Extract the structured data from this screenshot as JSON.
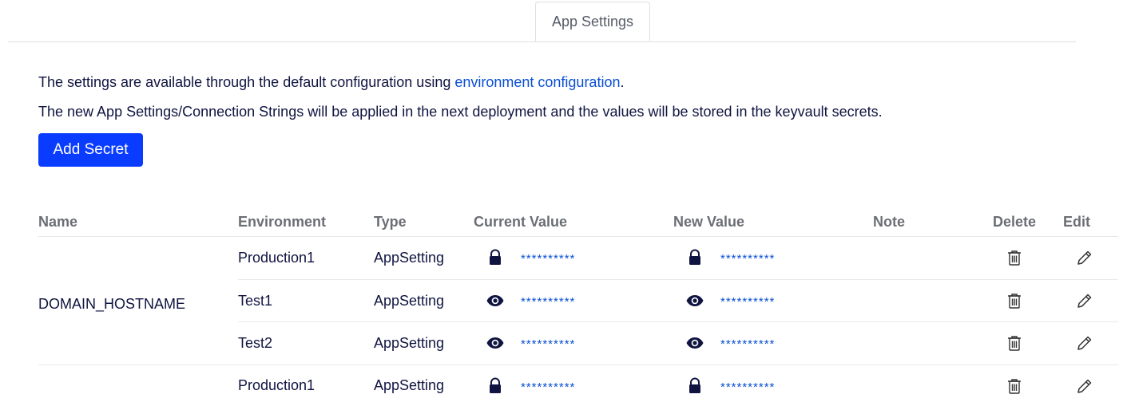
{
  "tabs": {
    "active": "App Settings"
  },
  "info": {
    "line1_prefix": "The settings are available through the default configuration using ",
    "line1_link": "environment configuration",
    "line1_suffix": ".",
    "line2": "The new App Settings/Connection Strings will be applied in the next deployment and the values will be stored in the keyvault secrets."
  },
  "actions": {
    "add_secret": "Add Secret"
  },
  "table": {
    "headers": {
      "name": "Name",
      "environment": "Environment",
      "type": "Type",
      "current_value": "Current Value",
      "new_value": "New Value",
      "note": "Note",
      "delete": "Delete",
      "edit": "Edit"
    },
    "groups": [
      {
        "name": "DOMAIN_HOSTNAME",
        "rows": [
          {
            "environment": "Production1",
            "type": "AppSetting",
            "current_icon": "lock-icon",
            "current_value": "**********",
            "new_icon": "lock-icon",
            "new_value": "**********",
            "note": ""
          },
          {
            "environment": "Test1",
            "type": "AppSetting",
            "current_icon": "eye-icon",
            "current_value": "**********",
            "new_icon": "eye-icon",
            "new_value": "**********",
            "note": ""
          },
          {
            "environment": "Test2",
            "type": "AppSetting",
            "current_icon": "eye-icon",
            "current_value": "**********",
            "new_icon": "eye-icon",
            "new_value": "**********",
            "note": ""
          }
        ]
      },
      {
        "name": "",
        "rows": [
          {
            "environment": "Production1",
            "type": "AppSetting",
            "current_icon": "lock-icon",
            "current_value": "**********",
            "new_icon": "lock-icon",
            "new_value": "**********",
            "note": ""
          }
        ]
      }
    ]
  },
  "colors": {
    "primary_button": "#0a3cff",
    "link": "#0a4fd4",
    "text": "#0f1440",
    "header_text": "#6b6e75",
    "divider": "#e6e8eb"
  }
}
